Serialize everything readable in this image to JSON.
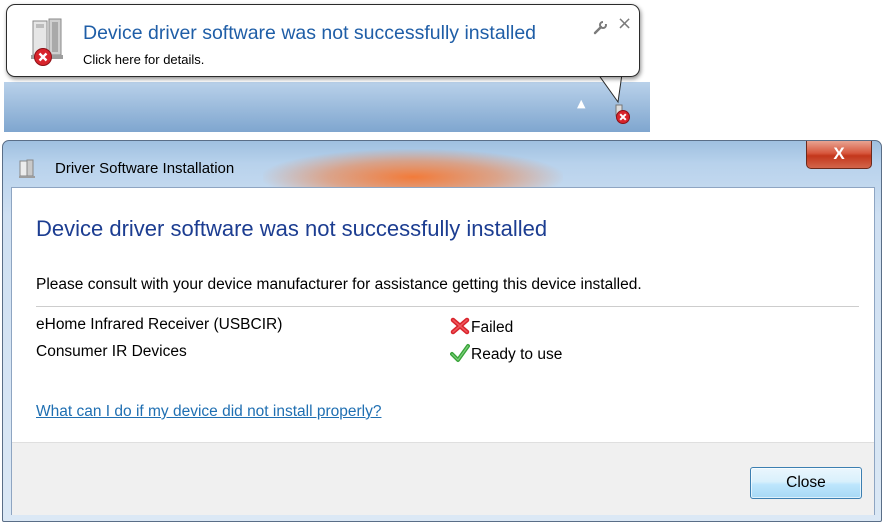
{
  "balloon": {
    "title": "Device driver software was not successfully installed",
    "subtitle": "Click here for details.",
    "close_glyph": "×",
    "icons": {
      "device": "device-installer-icon",
      "error": "error-badge-icon",
      "options": "wrench-icon",
      "close": "close-icon"
    }
  },
  "taskbar": {
    "show_hidden_glyph": "▲",
    "tray_icon": "device-error-tray-icon"
  },
  "dialog": {
    "title": "Driver Software Installation",
    "title_icon": "device-installer-icon",
    "close_glyph": "X",
    "heading": "Device driver software was not successfully installed",
    "message": "Please consult with your device manufacturer for assistance getting this device installed.",
    "devices": [
      {
        "name": "eHome Infrared Receiver (USBCIR)",
        "status": "Failed",
        "status_icon": "red-x-icon"
      },
      {
        "name": "Consumer IR Devices",
        "status": "Ready to use",
        "status_icon": "green-check-icon"
      }
    ],
    "help_link": "What can I do if my device did not install properly?",
    "close_button": "Close"
  },
  "colors": {
    "link": "#1f6fb2",
    "heading": "#1c3d91",
    "balloon_title": "#1f5ea7",
    "error_red": "#d8242c",
    "success_green": "#3aa33a",
    "close_button_red": "#c3371b"
  }
}
